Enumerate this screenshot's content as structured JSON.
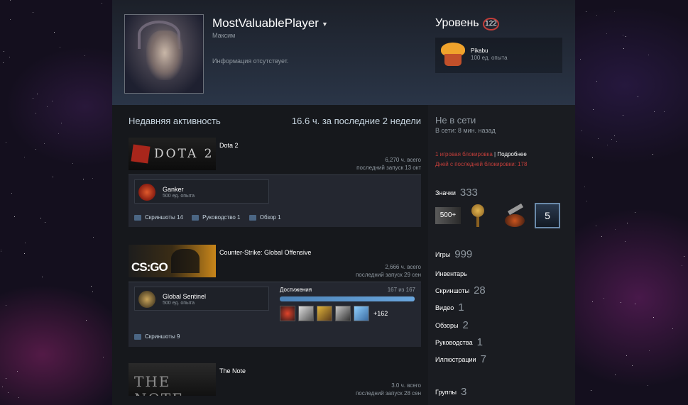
{
  "profile": {
    "username": "MostValuablePlayer",
    "real_name": "Максим",
    "summary": "Информация отсутствует."
  },
  "level": {
    "label": "Уровень",
    "value": "122",
    "badge_name": "Pikabu",
    "badge_xp": "100 ед. опыта"
  },
  "recent": {
    "title": "Недавняя активность",
    "hours": "16.6 ч. за последние 2 недели",
    "games": [
      {
        "name": "Dota 2",
        "capsule_text": "DOTA 2",
        "hours_total": "6,270 ч. всего",
        "last_played": "последний запуск 13 окт",
        "badge_name": "Ganker",
        "badge_xp": "500 ед. опыта",
        "stats": [
          "Скриншоты 14",
          "Руководство 1",
          "Обзор 1"
        ]
      },
      {
        "name": "Counter-Strike: Global Offensive",
        "capsule_text": "CS:GO",
        "hours_total": "2,666 ч. всего",
        "last_played": "последний запуск 29 сен",
        "badge_name": "Global Sentinel",
        "badge_xp": "500 ед. опыта",
        "achievements_label": "Достижения",
        "achievements_count": "167 из 167",
        "achievements_progress": 1.0,
        "achievements_more": "+162",
        "stats": [
          "Скриншоты 9"
        ]
      },
      {
        "name": "The Note",
        "capsule_text": "THE NOTE",
        "hours_total": "3.0 ч. всего",
        "last_played": "последний запуск 28 сен"
      }
    ]
  },
  "status": {
    "title": "Не в сети",
    "sub": "В сети: 8 мин. назад",
    "ban_line": "1 игровая блокировка",
    "ban_sep": " | ",
    "ban_more": "Подробнее",
    "ban_days": "Дней с последней блокировки: 178"
  },
  "counts": {
    "badges_label": "Значки",
    "badges": "333",
    "badge_icons": [
      {
        "name": "badge-500-icon",
        "text": "500+"
      },
      {
        "name": "medal-icon",
        "text": ""
      },
      {
        "name": "gun-badge-icon",
        "text": ""
      },
      {
        "name": "level-5-badge-icon",
        "text": "5"
      }
    ],
    "games_label": "Игры",
    "games": "999",
    "inventory_label": "Инвентарь",
    "screenshots_label": "Скриншоты",
    "screenshots": "28",
    "videos_label": "Видео",
    "videos": "1",
    "reviews_label": "Обзоры",
    "reviews": "2",
    "guides_label": "Руководства",
    "guides": "1",
    "artwork_label": "Иллюстрации",
    "artwork": "7",
    "groups_label": "Группы",
    "groups": "3"
  },
  "colors": {
    "accent_blue": "#4c83b8",
    "ban_red": "#c23e3a",
    "level_ring": "#c23e3a"
  }
}
